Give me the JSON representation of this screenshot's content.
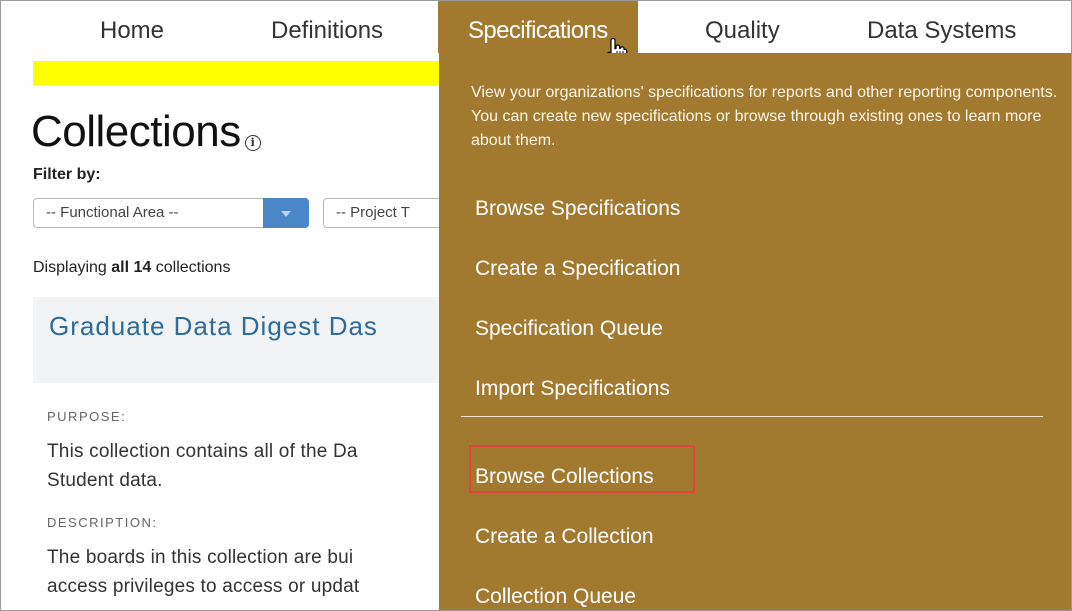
{
  "nav": {
    "items": [
      {
        "label": "Home"
      },
      {
        "label": "Definitions"
      },
      {
        "label": "Specifications"
      },
      {
        "label": "Quality"
      },
      {
        "label": "Data Systems"
      }
    ]
  },
  "page": {
    "title": "Collections",
    "info_glyph": "i",
    "filter_label": "Filter by:",
    "filters": {
      "functional_area": "-- Functional Area --",
      "project_type": "-- Project T"
    },
    "displaying": {
      "prefix": "Displaying ",
      "bold": "all 14",
      "suffix": " collections"
    },
    "card_title": "Graduate Data Digest Das",
    "purpose_label": "PURPOSE:",
    "purpose_line1": "This collection contains all of the Da",
    "purpose_line2": "Student data.",
    "description_label": "DESCRIPTION:",
    "description_line1": "The boards in this collection are bui",
    "description_line2": "access privileges to access or updat"
  },
  "dropdown": {
    "description": "View your organizations' specifications for reports and other reporting components. You can create new specifications or browse through existing ones to learn more about them.",
    "items": [
      {
        "label": "Browse Specifications"
      },
      {
        "label": "Create a Specification"
      },
      {
        "label": "Specification Queue"
      },
      {
        "label": "Import Specifications"
      },
      {
        "label": "Browse Collections"
      },
      {
        "label": "Create a Collection"
      },
      {
        "label": "Collection Queue"
      }
    ]
  },
  "colors": {
    "dropdown_bg": "#a17a2f",
    "highlight_bar": "#ffff00",
    "link_blue": "#2c6c9c",
    "select_button": "#4a86c8",
    "callout_border": "#e0463c"
  }
}
